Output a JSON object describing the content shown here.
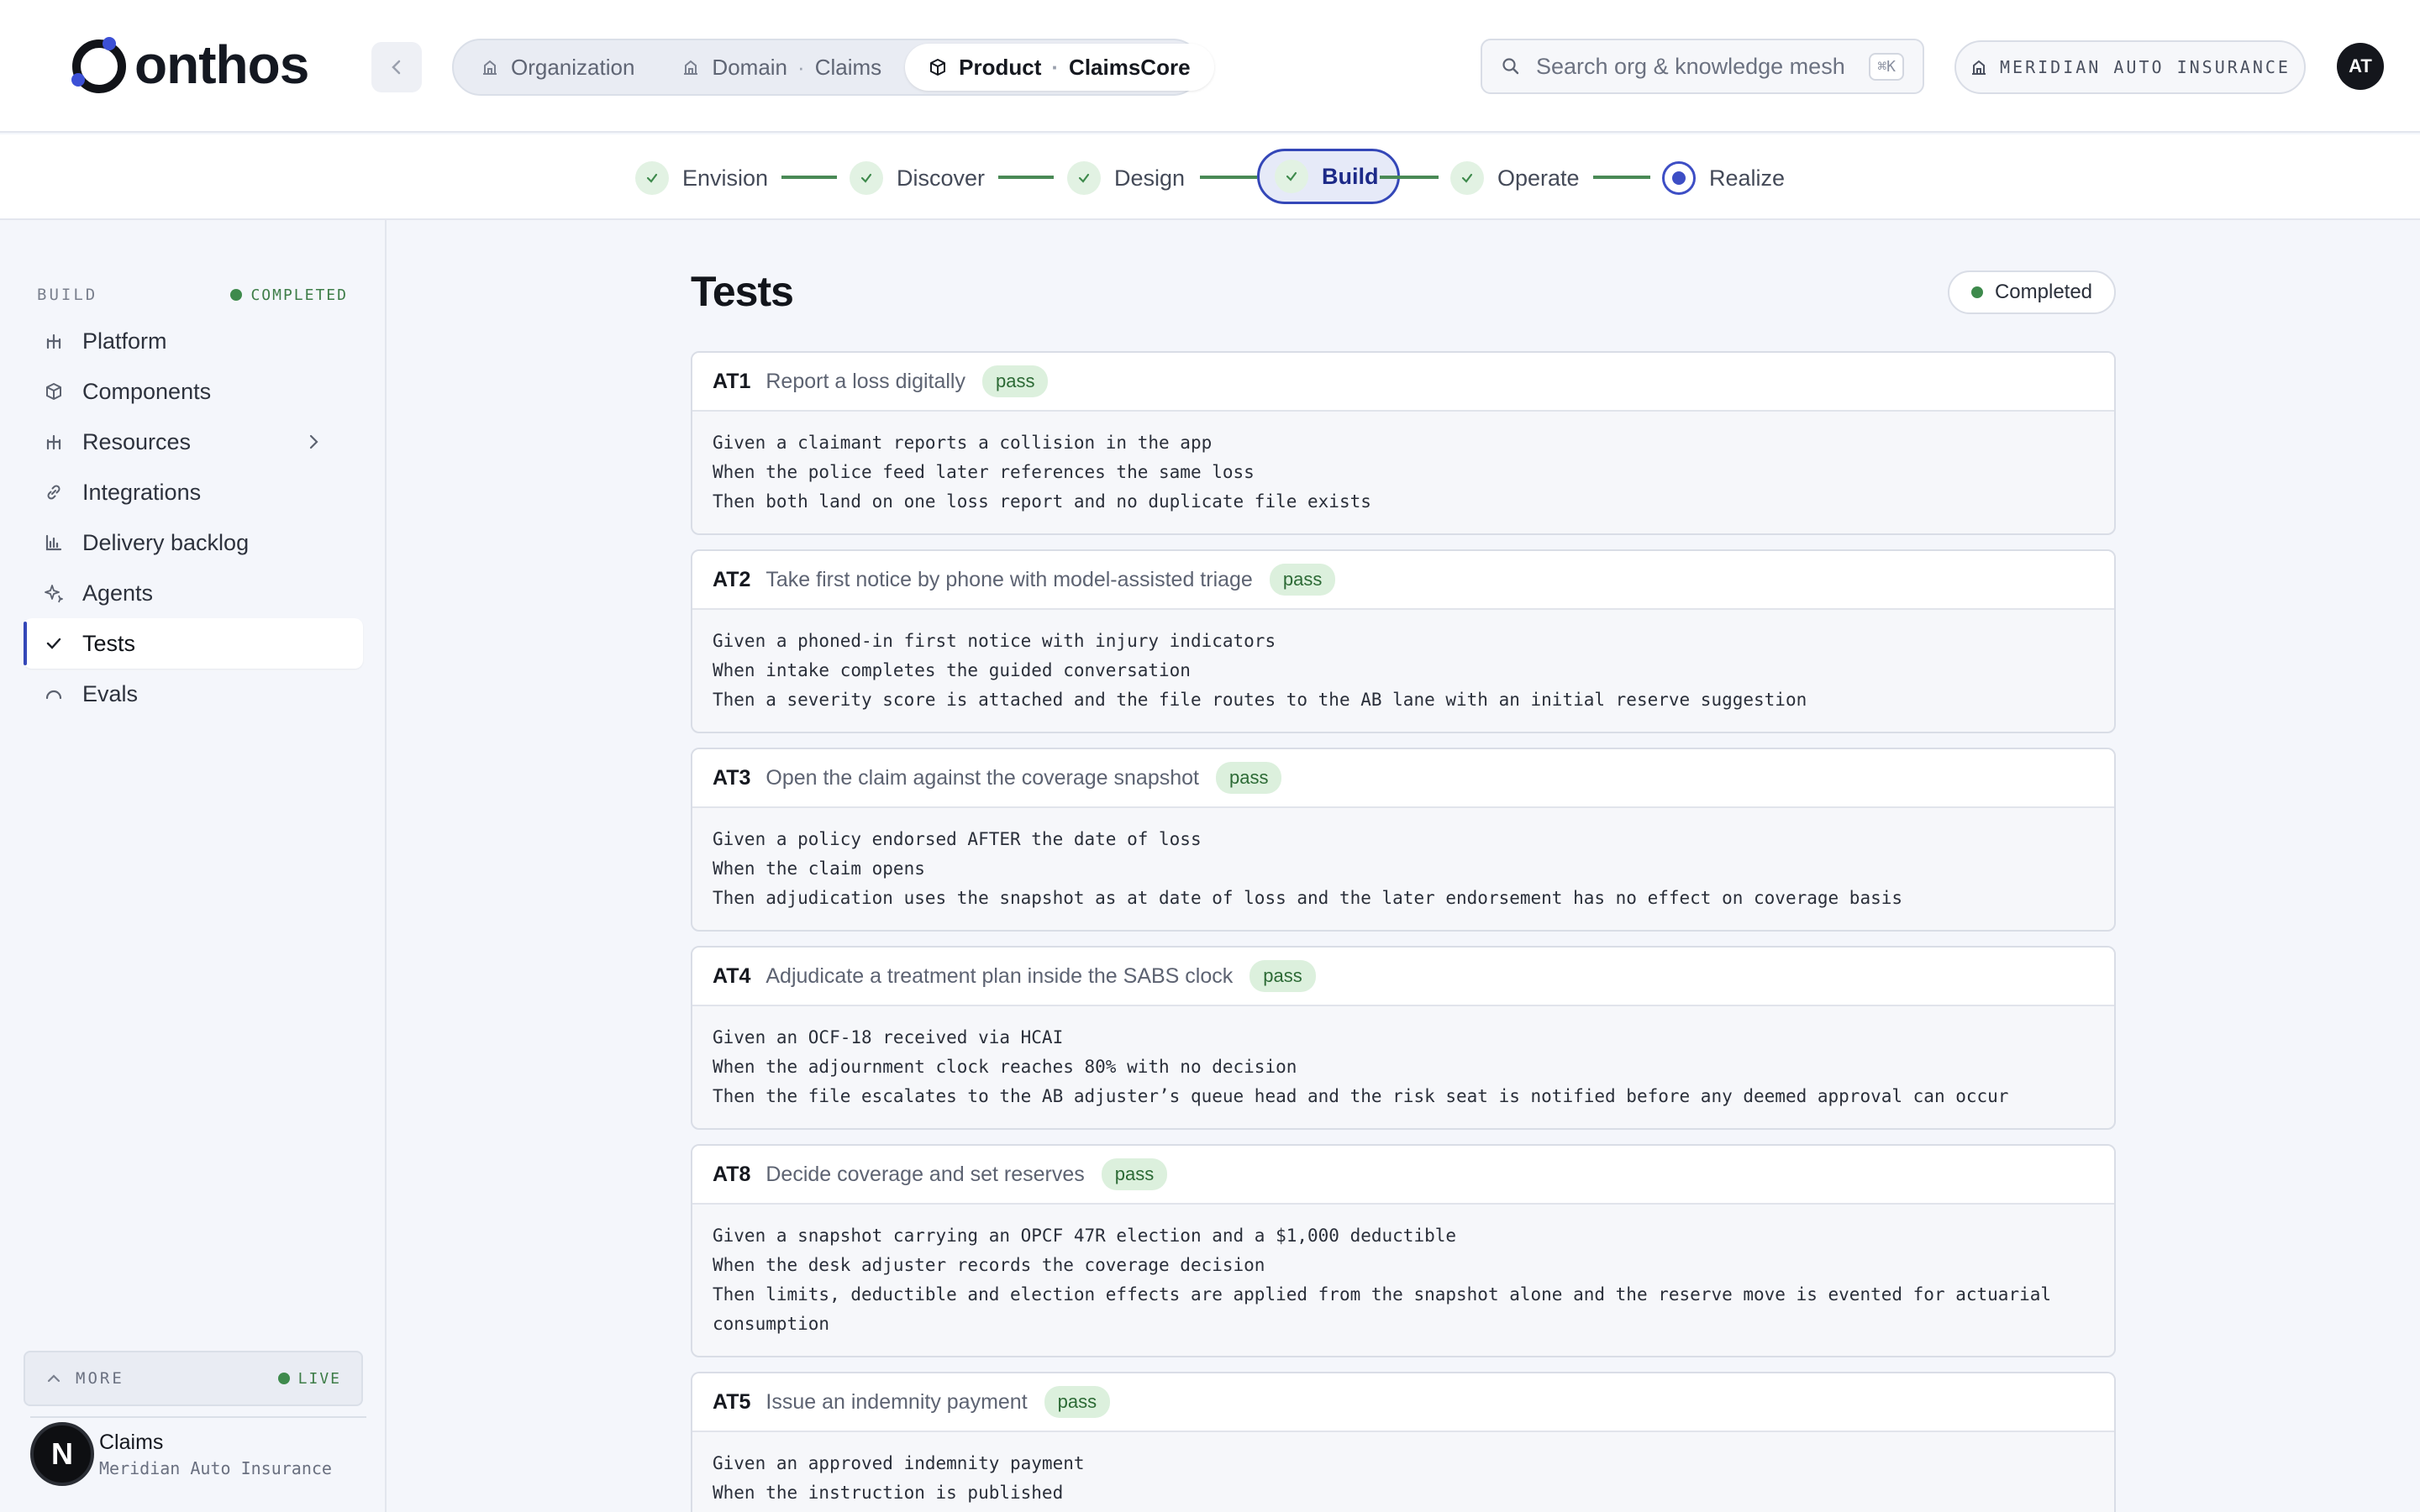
{
  "header": {
    "logo_text": "onthos",
    "breadcrumbs": [
      {
        "label": "Organization",
        "sub": ""
      },
      {
        "label": "Domain",
        "sub": "Claims"
      },
      {
        "label": "Product",
        "sub": "ClaimsCore"
      }
    ],
    "crumb_sep": "·",
    "search_placeholder": "Search org & knowledge mesh",
    "search_kbd": "⌘K",
    "org_label": "MERIDIAN AUTO INSURANCE",
    "user_initials": "AT"
  },
  "stepper": {
    "steps": [
      {
        "label": "Envision",
        "state": "done"
      },
      {
        "label": "Discover",
        "state": "done"
      },
      {
        "label": "Design",
        "state": "done"
      },
      {
        "label": "Build",
        "state": "current"
      },
      {
        "label": "Operate",
        "state": "done"
      },
      {
        "label": "Realize",
        "state": "pending"
      }
    ]
  },
  "sidebar": {
    "section": "BUILD",
    "status": "COMPLETED",
    "items": [
      {
        "label": "Platform",
        "icon": "platform-icon"
      },
      {
        "label": "Components",
        "icon": "cube-icon"
      },
      {
        "label": "Resources",
        "icon": "resources-icon"
      },
      {
        "label": "Integrations",
        "icon": "link-icon"
      },
      {
        "label": "Delivery backlog",
        "icon": "bar-chart-icon"
      },
      {
        "label": "Agents",
        "icon": "sparkle-icon"
      },
      {
        "label": "Tests",
        "icon": "check-icon"
      },
      {
        "label": "Evals",
        "icon": "gauge-icon"
      }
    ],
    "active": "Tests",
    "more_label": "MORE",
    "live_label": "LIVE",
    "workspace_name": "Claims",
    "workspace_org": "Meridian Auto Insurance",
    "workspace_logo_letter": "N"
  },
  "main": {
    "title": "Tests",
    "status": "Completed",
    "tests": [
      {
        "id": "AT1",
        "name": "Report a loss digitally",
        "result": "pass",
        "lines": [
          "Given a claimant reports a collision in the app",
          "When the police feed later references the same loss",
          "Then both land on one loss report and no duplicate file exists"
        ]
      },
      {
        "id": "AT2",
        "name": "Take first notice by phone with model-assisted triage",
        "result": "pass",
        "lines": [
          "Given a phoned-in first notice with injury indicators",
          "When intake completes the guided conversation",
          "Then a severity score is attached and the file routes to the AB lane with an initial reserve suggestion"
        ]
      },
      {
        "id": "AT3",
        "name": "Open the claim against the coverage snapshot",
        "result": "pass",
        "lines": [
          "Given a policy endorsed AFTER the date of loss",
          "When the claim opens",
          "Then adjudication uses the snapshot as at date of loss and the later endorsement has no effect on coverage basis"
        ]
      },
      {
        "id": "AT4",
        "name": "Adjudicate a treatment plan inside the SABS clock",
        "result": "pass",
        "lines": [
          "Given an OCF-18 received via HCAI",
          "When the adjournment clock reaches 80% with no decision",
          "Then the file escalates to the AB adjuster’s queue head and the risk seat is notified before any deemed approval can occur"
        ]
      },
      {
        "id": "AT8",
        "name": "Decide coverage and set reserves",
        "result": "pass",
        "lines": [
          "Given a snapshot carrying an OPCF 47R election and a $1,000 deductible",
          "When the desk adjuster records the coverage decision",
          "Then limits, deductible and election effects are applied from the snapshot alone and the reserve move is evented for actuarial",
          "consumption"
        ]
      },
      {
        "id": "AT5",
        "name": "Issue an indemnity payment",
        "result": "pass",
        "lines": [
          "Given an approved indemnity payment",
          "When the instruction is published"
        ]
      }
    ]
  }
}
